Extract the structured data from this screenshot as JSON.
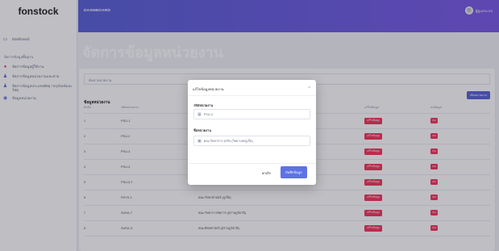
{
  "app": {
    "brand": "fonstock"
  },
  "sidebar": {
    "dashboard_label": "Dashboard",
    "section_label": "จัดการข้อมูลพื้นฐาน",
    "items": [
      {
        "label": "จัดการข้อมูลผู้ใช้งาน",
        "icon": "user-icon"
      },
      {
        "label": "จัดการข้อมูลหน่วยงานและฝ่าย",
        "icon": "person-icon"
      },
      {
        "label": "จัดการข้อมูลประเภทพัสดุ / ครุภัณฑ์และวัสดุ",
        "icon": "person-icon"
      },
      {
        "label": "ข้อมูลหน่วยงาน",
        "icon": "building-icon"
      }
    ]
  },
  "topbar": {
    "breadcrumb": "DASHBOARD",
    "username": "ผู้ดูแลระบบ"
  },
  "page": {
    "title": "จัดการข้อมูลหน่วยงาน"
  },
  "card": {
    "search_placeholder": "ค้นหาหน่วยงาน",
    "title": "ข้อมูลหน่วยงาน",
    "add_button": "เพิ่มหน่วยงาน",
    "columns": [
      "ลำดับ",
      "รหัสหน่วยงาน",
      "ชื่อหน่วยงาน",
      "แก้ไขข้อมูล",
      "ลบข้อมูล"
    ],
    "rows": [
      {
        "order": "1",
        "code": "PSU-1",
        "name": ""
      },
      {
        "order": "2",
        "code": "PSU-2",
        "name": ""
      },
      {
        "order": "3",
        "code": "PSU-3",
        "name": ""
      },
      {
        "order": "4",
        "code": "PSU-4",
        "name": ""
      },
      {
        "order": "5",
        "code": "PSU-5-T",
        "name": "คณะวิศวกรรมศาสตร์ (วิทยาเขตตรัง)"
      },
      {
        "order": "6",
        "code": "PHYS-1",
        "name": "คณะวิทยาศาสตร์ (ภูเก็ต)"
      },
      {
        "order": "7",
        "code": "SURA-T",
        "name": "คณะวิทยาการจัดการ (สุราษฎร์ธานี)"
      },
      {
        "order": "8",
        "code": "SURA-S",
        "name": "คณะศิลปศาสตร์ (สุราษฎร์ธานี)"
      }
    ],
    "edit_label": "แก้ไขข้อมูล",
    "delete_label": "ลบ"
  },
  "modal": {
    "title": "แก้ไขข้อมูลหน่วยงาน",
    "close": "×",
    "code_label": "รหัสหน่วยงาน",
    "code_value": "PSU-4",
    "name_label": "ชื่อหน่วยงาน",
    "name_value": "คณะวิทยาการ ธุรกิจ (วิทยาเขตภูเก็ต)",
    "cancel": "ยกเลิก",
    "save": "บันทึกข้อมูล"
  },
  "colors": {
    "accent": "#5e72e4",
    "danger": "#f5365c",
    "topbar": "#6a5ee0"
  }
}
